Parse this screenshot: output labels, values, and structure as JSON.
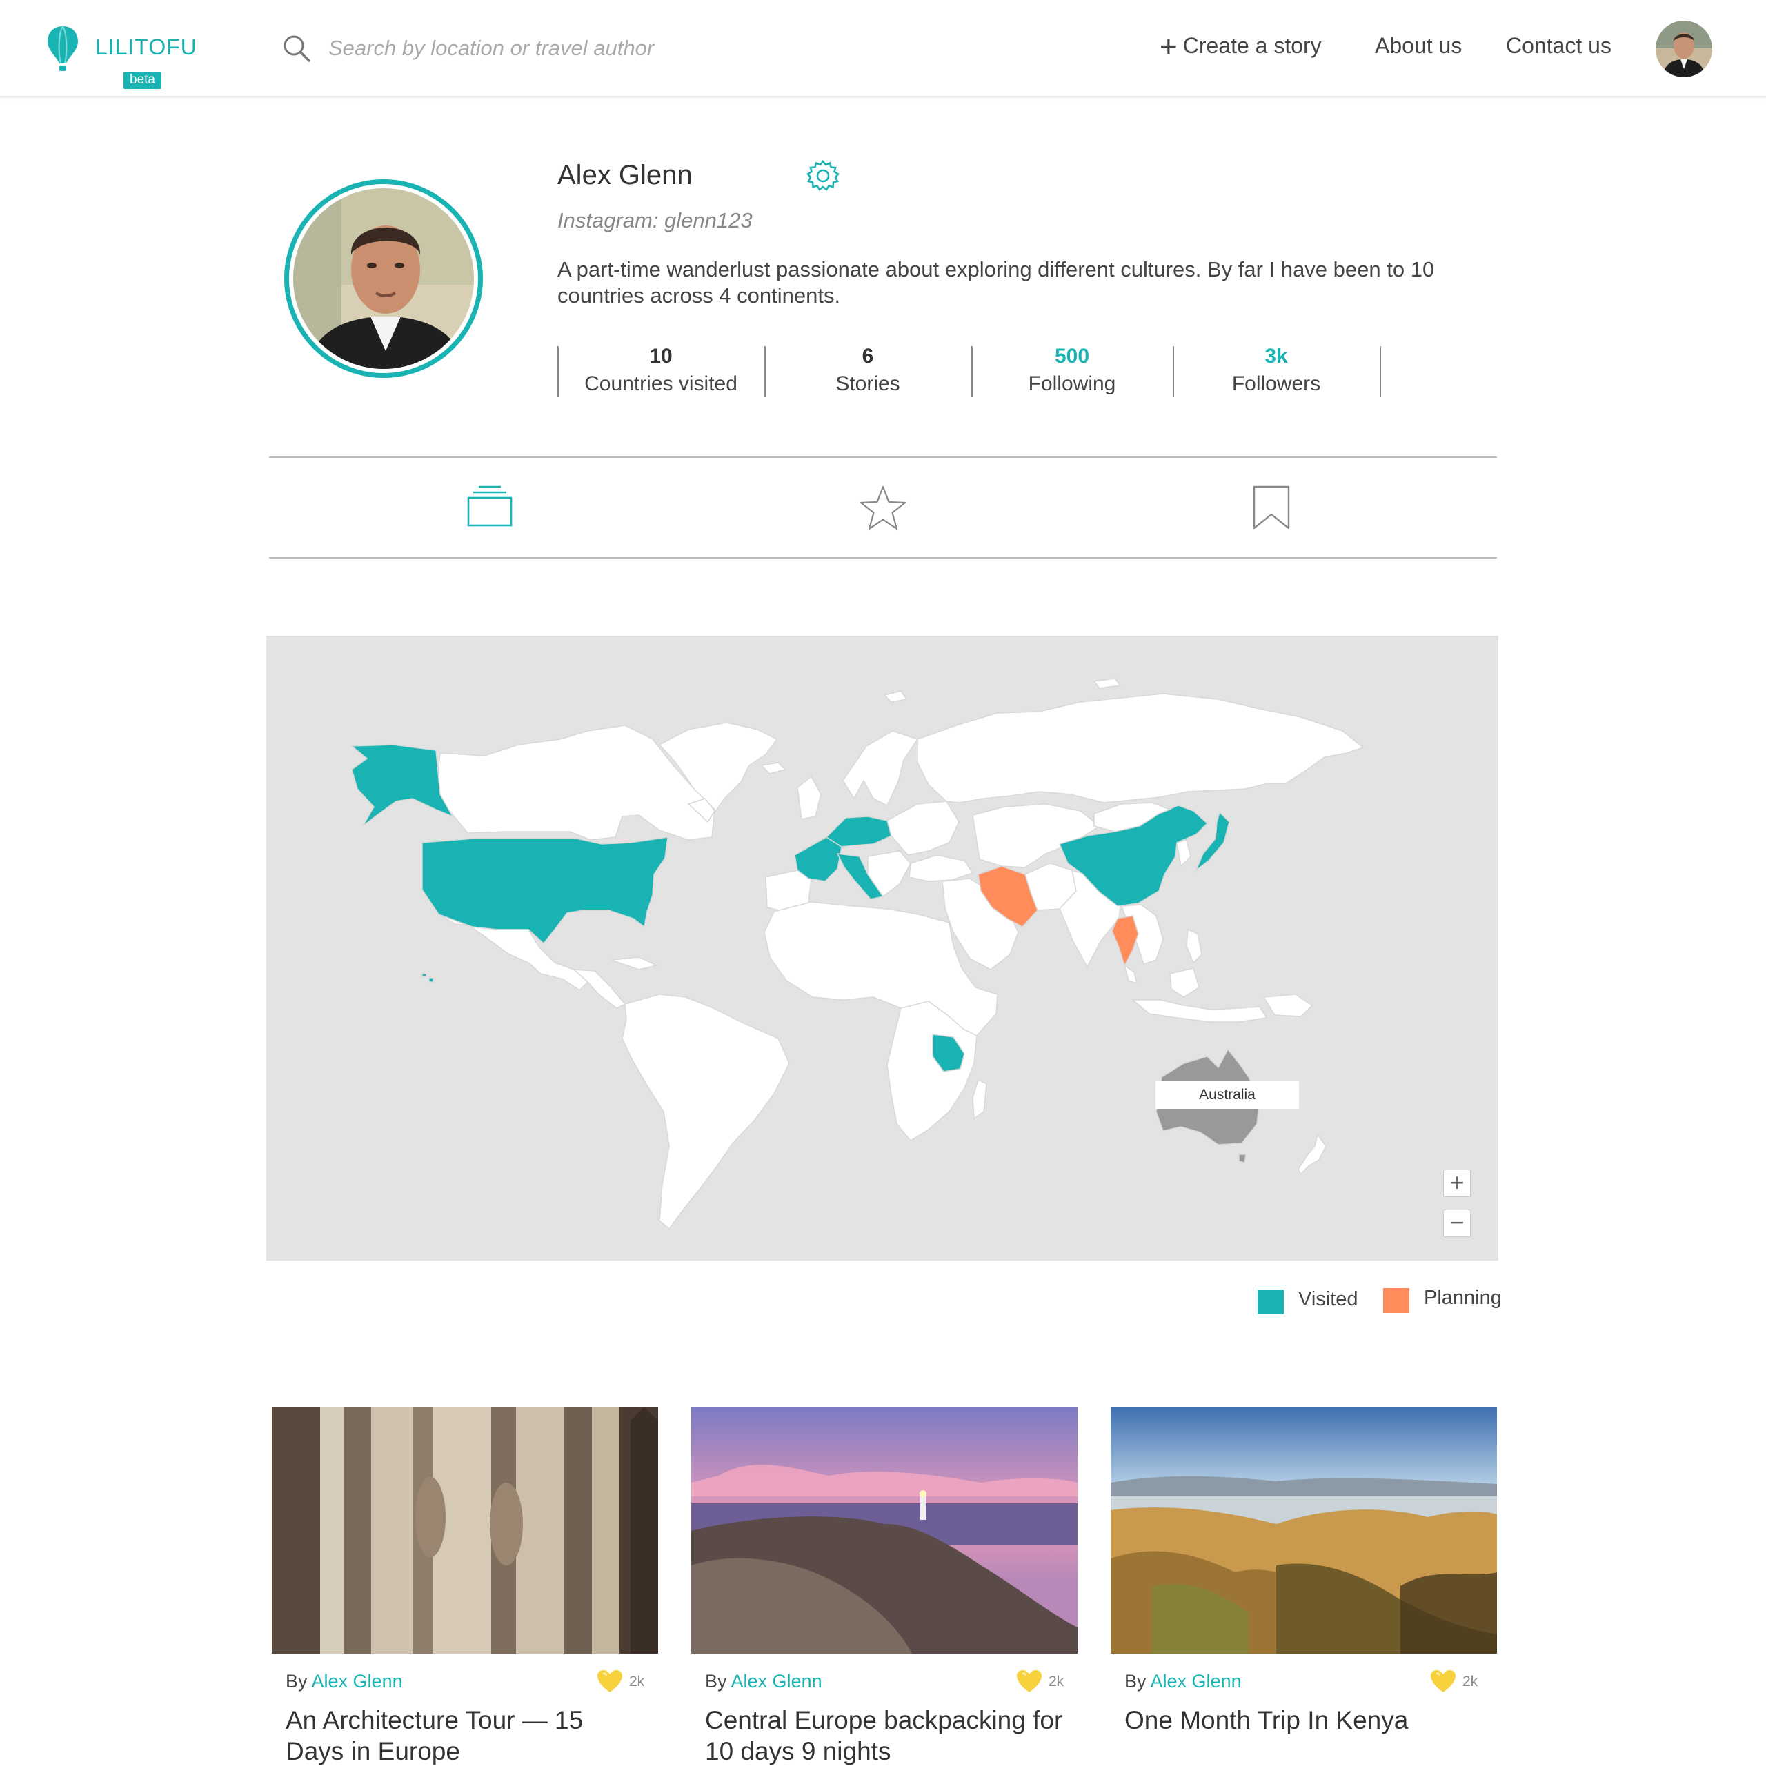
{
  "header": {
    "logo_text": "LILITOFU",
    "beta_label": "beta",
    "search_placeholder": "Search by location or travel author",
    "nav": {
      "create_story": "Create a story",
      "about_us": "About us",
      "contact_us": "Contact us"
    }
  },
  "profile": {
    "name": "Alex Glenn",
    "instagram": "Instagram: glenn123",
    "bio": "A part-time wanderlust passionate about exploring different cultures. By far I have been to 10 countries across 4 continents.",
    "stats": [
      {
        "value": "10",
        "label": "Countries visited"
      },
      {
        "value": "6",
        "label": "Stories"
      },
      {
        "value": "500",
        "label": "Following"
      },
      {
        "value": "3k",
        "label": "Followers"
      }
    ]
  },
  "tabs": [
    {
      "icon": "stack-icon",
      "active": true
    },
    {
      "icon": "star-icon",
      "active": false
    },
    {
      "icon": "bookmark-icon",
      "active": false
    }
  ],
  "map": {
    "hover_label": "Australia",
    "zoom_in": "+",
    "zoom_out": "−",
    "colors": {
      "visited": "#1ab3b3",
      "planning": "#ff8c5a",
      "land": "#ffffff",
      "water": "#e3e3e3",
      "hover": "#999999"
    }
  },
  "legend": {
    "visited": "Visited",
    "planning": "Planning"
  },
  "stories": [
    {
      "by": "By",
      "author": "Alex Glenn",
      "likes": "2k",
      "title": "An Architecture Tour — 15 Days in Europe"
    },
    {
      "by": "By",
      "author": "Alex Glenn",
      "likes": "2k",
      "title": "Central Europe backpacking for 10 days 9 nights"
    },
    {
      "by": "By",
      "author": "Alex Glenn",
      "likes": "2k",
      "title": "One Month Trip In Kenya"
    }
  ]
}
